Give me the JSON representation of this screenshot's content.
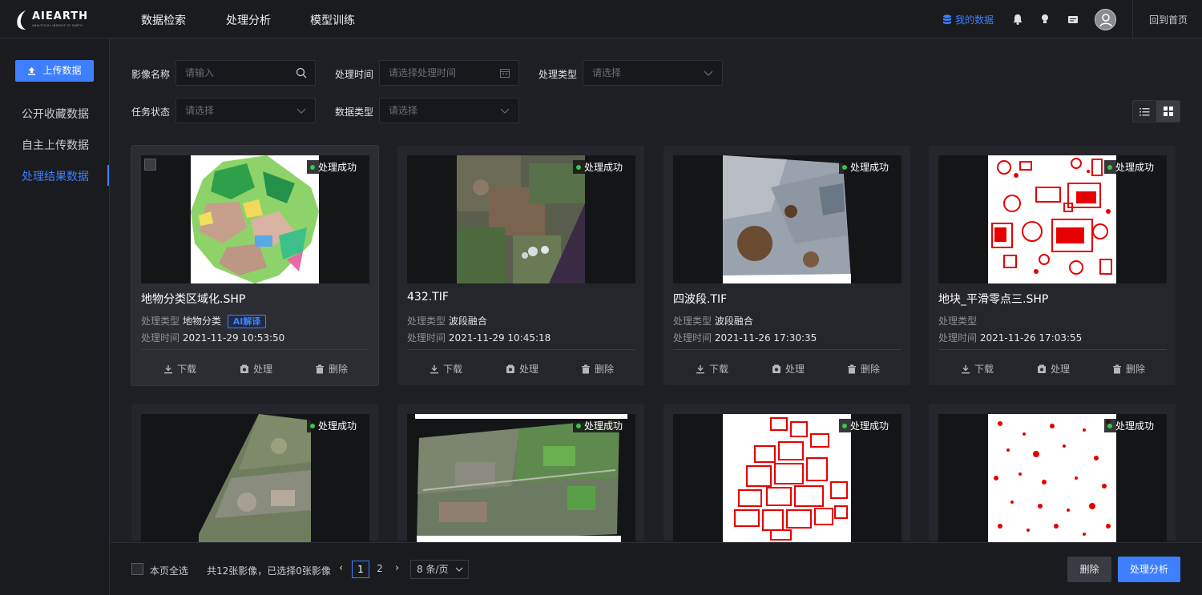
{
  "brand": {
    "name": "AIEARTH",
    "tagline": "ANALYTICAL INSIGHT OF EARTH"
  },
  "nav": {
    "items": [
      "数据检索",
      "处理分析",
      "模型训练"
    ],
    "my_data": "我的数据",
    "home": "回到首页"
  },
  "sidebar": {
    "upload": "上传数据",
    "items": [
      "公开收藏数据",
      "自主上传数据",
      "处理结果数据"
    ],
    "active_index": 2
  },
  "filters": {
    "image_name": {
      "label": "影像名称",
      "placeholder": "请输入"
    },
    "process_time": {
      "label": "处理时间",
      "placeholder": "请选择处理时间"
    },
    "process_type": {
      "label": "处理类型",
      "placeholder": "请选择"
    },
    "task_status": {
      "label": "任务状态",
      "placeholder": "请选择"
    },
    "data_type": {
      "label": "数据类型",
      "placeholder": "请选择"
    }
  },
  "labels": {
    "process_type": "处理类型",
    "process_time": "处理时间",
    "download": "下载",
    "process": "处理",
    "delete": "删除",
    "status_success": "处理成功",
    "ai_tag": "AI解译"
  },
  "cards": [
    {
      "title": "地物分类区域化.SHP",
      "type": "地物分类",
      "time": "2021-11-29 10:53:50",
      "status": "处理成功",
      "ai": true
    },
    {
      "title": "432.TIF",
      "type": "波段融合",
      "time": "2021-11-29 10:45:18",
      "status": "处理成功"
    },
    {
      "title": "四波段.TIF",
      "type": "波段融合",
      "time": "2021-11-26 17:30:35",
      "status": "处理成功"
    },
    {
      "title": "地块_平滑零点三.SHP",
      "type": "",
      "time": "2021-11-26 17:03:55",
      "status": "处理成功"
    },
    {
      "status": "处理成功"
    },
    {
      "status": "处理成功"
    },
    {
      "status": "处理成功"
    },
    {
      "status": "处理成功"
    }
  ],
  "footer": {
    "select_page": "本页全选",
    "summary": "共12张影像，已选择0张影像",
    "pages": [
      "1",
      "2"
    ],
    "current_page": 1,
    "page_size": "8 条/页",
    "delete": "删除",
    "process": "处理分析"
  },
  "colors": {
    "accent": "#3d7fff",
    "success": "#39c54a",
    "background": "#1e1f24"
  }
}
